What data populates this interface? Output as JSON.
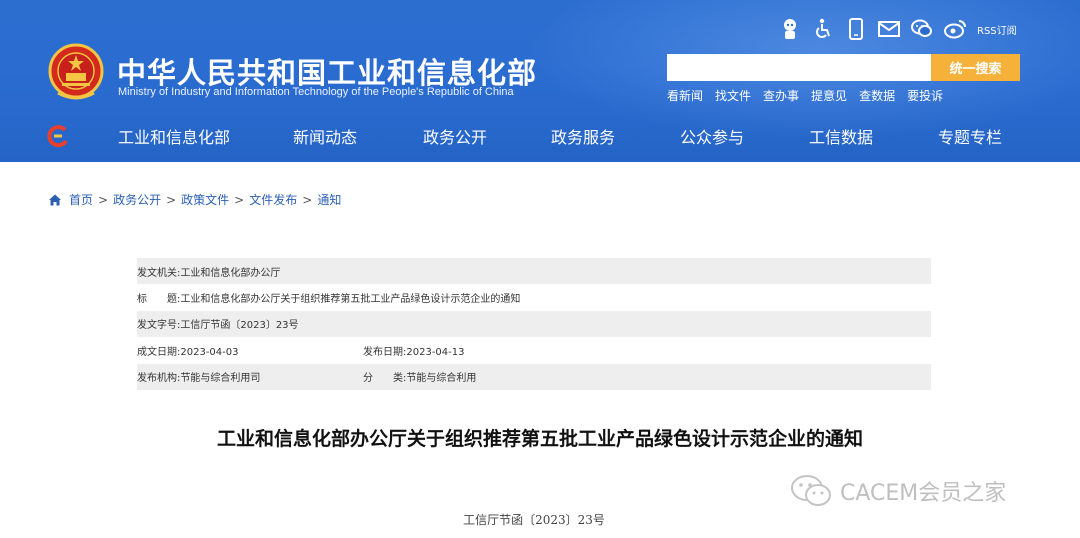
{
  "header": {
    "title": "中华人民共和国工业和信息化部",
    "subtitle": "Ministry of Industry and Information Technology of the People's Republic of China",
    "tool_icons": [
      "robot-icon",
      "accessibility-icon",
      "mobile-icon",
      "mail-icon",
      "wechat-icon",
      "weibo-icon"
    ],
    "rss_label": "RSS订阅",
    "search_placeholder": "",
    "search_button": "统一搜索",
    "quick_links": [
      "看新闻",
      "找文件",
      "查办事",
      "提意见",
      "查数据",
      "要投诉"
    ],
    "accent_color": "#2a6bd0",
    "button_color": "#f6b13a"
  },
  "nav": {
    "items": [
      "工业和信息化部",
      "新闻动态",
      "政务公开",
      "政务服务",
      "公众参与",
      "工信数据",
      "专题专栏"
    ]
  },
  "breadcrumb": [
    "首页",
    "政务公开",
    "政策文件",
    "文件发布",
    "通知"
  ],
  "info": {
    "issuer_label": "发文机关:",
    "issuer": "工业和信息化部办公厅",
    "title_label": "标　　题:",
    "title": "工业和信息化部办公厅关于组织推荐第五批工业产品绿色设计示范企业的通知",
    "docno_label": "发文字号:",
    "docno": "工信厅节函〔2023〕23号",
    "created_label": "成文日期:",
    "created": "2023-04-03",
    "published_label": "发布日期:",
    "published": "2023-04-13",
    "publisher_label": "发布机构:",
    "publisher": "节能与综合利用司",
    "category_label": "分　　类:",
    "category": "节能与综合利用"
  },
  "article": {
    "title": "工业和信息化部办公厅关于组织推荐第五批工业产品绿色设计示范企业的通知",
    "doc_number": "工信厅节函〔2023〕23号"
  },
  "watermark": {
    "text": "CACEM会员之家",
    "icon": "wechat-icon"
  }
}
